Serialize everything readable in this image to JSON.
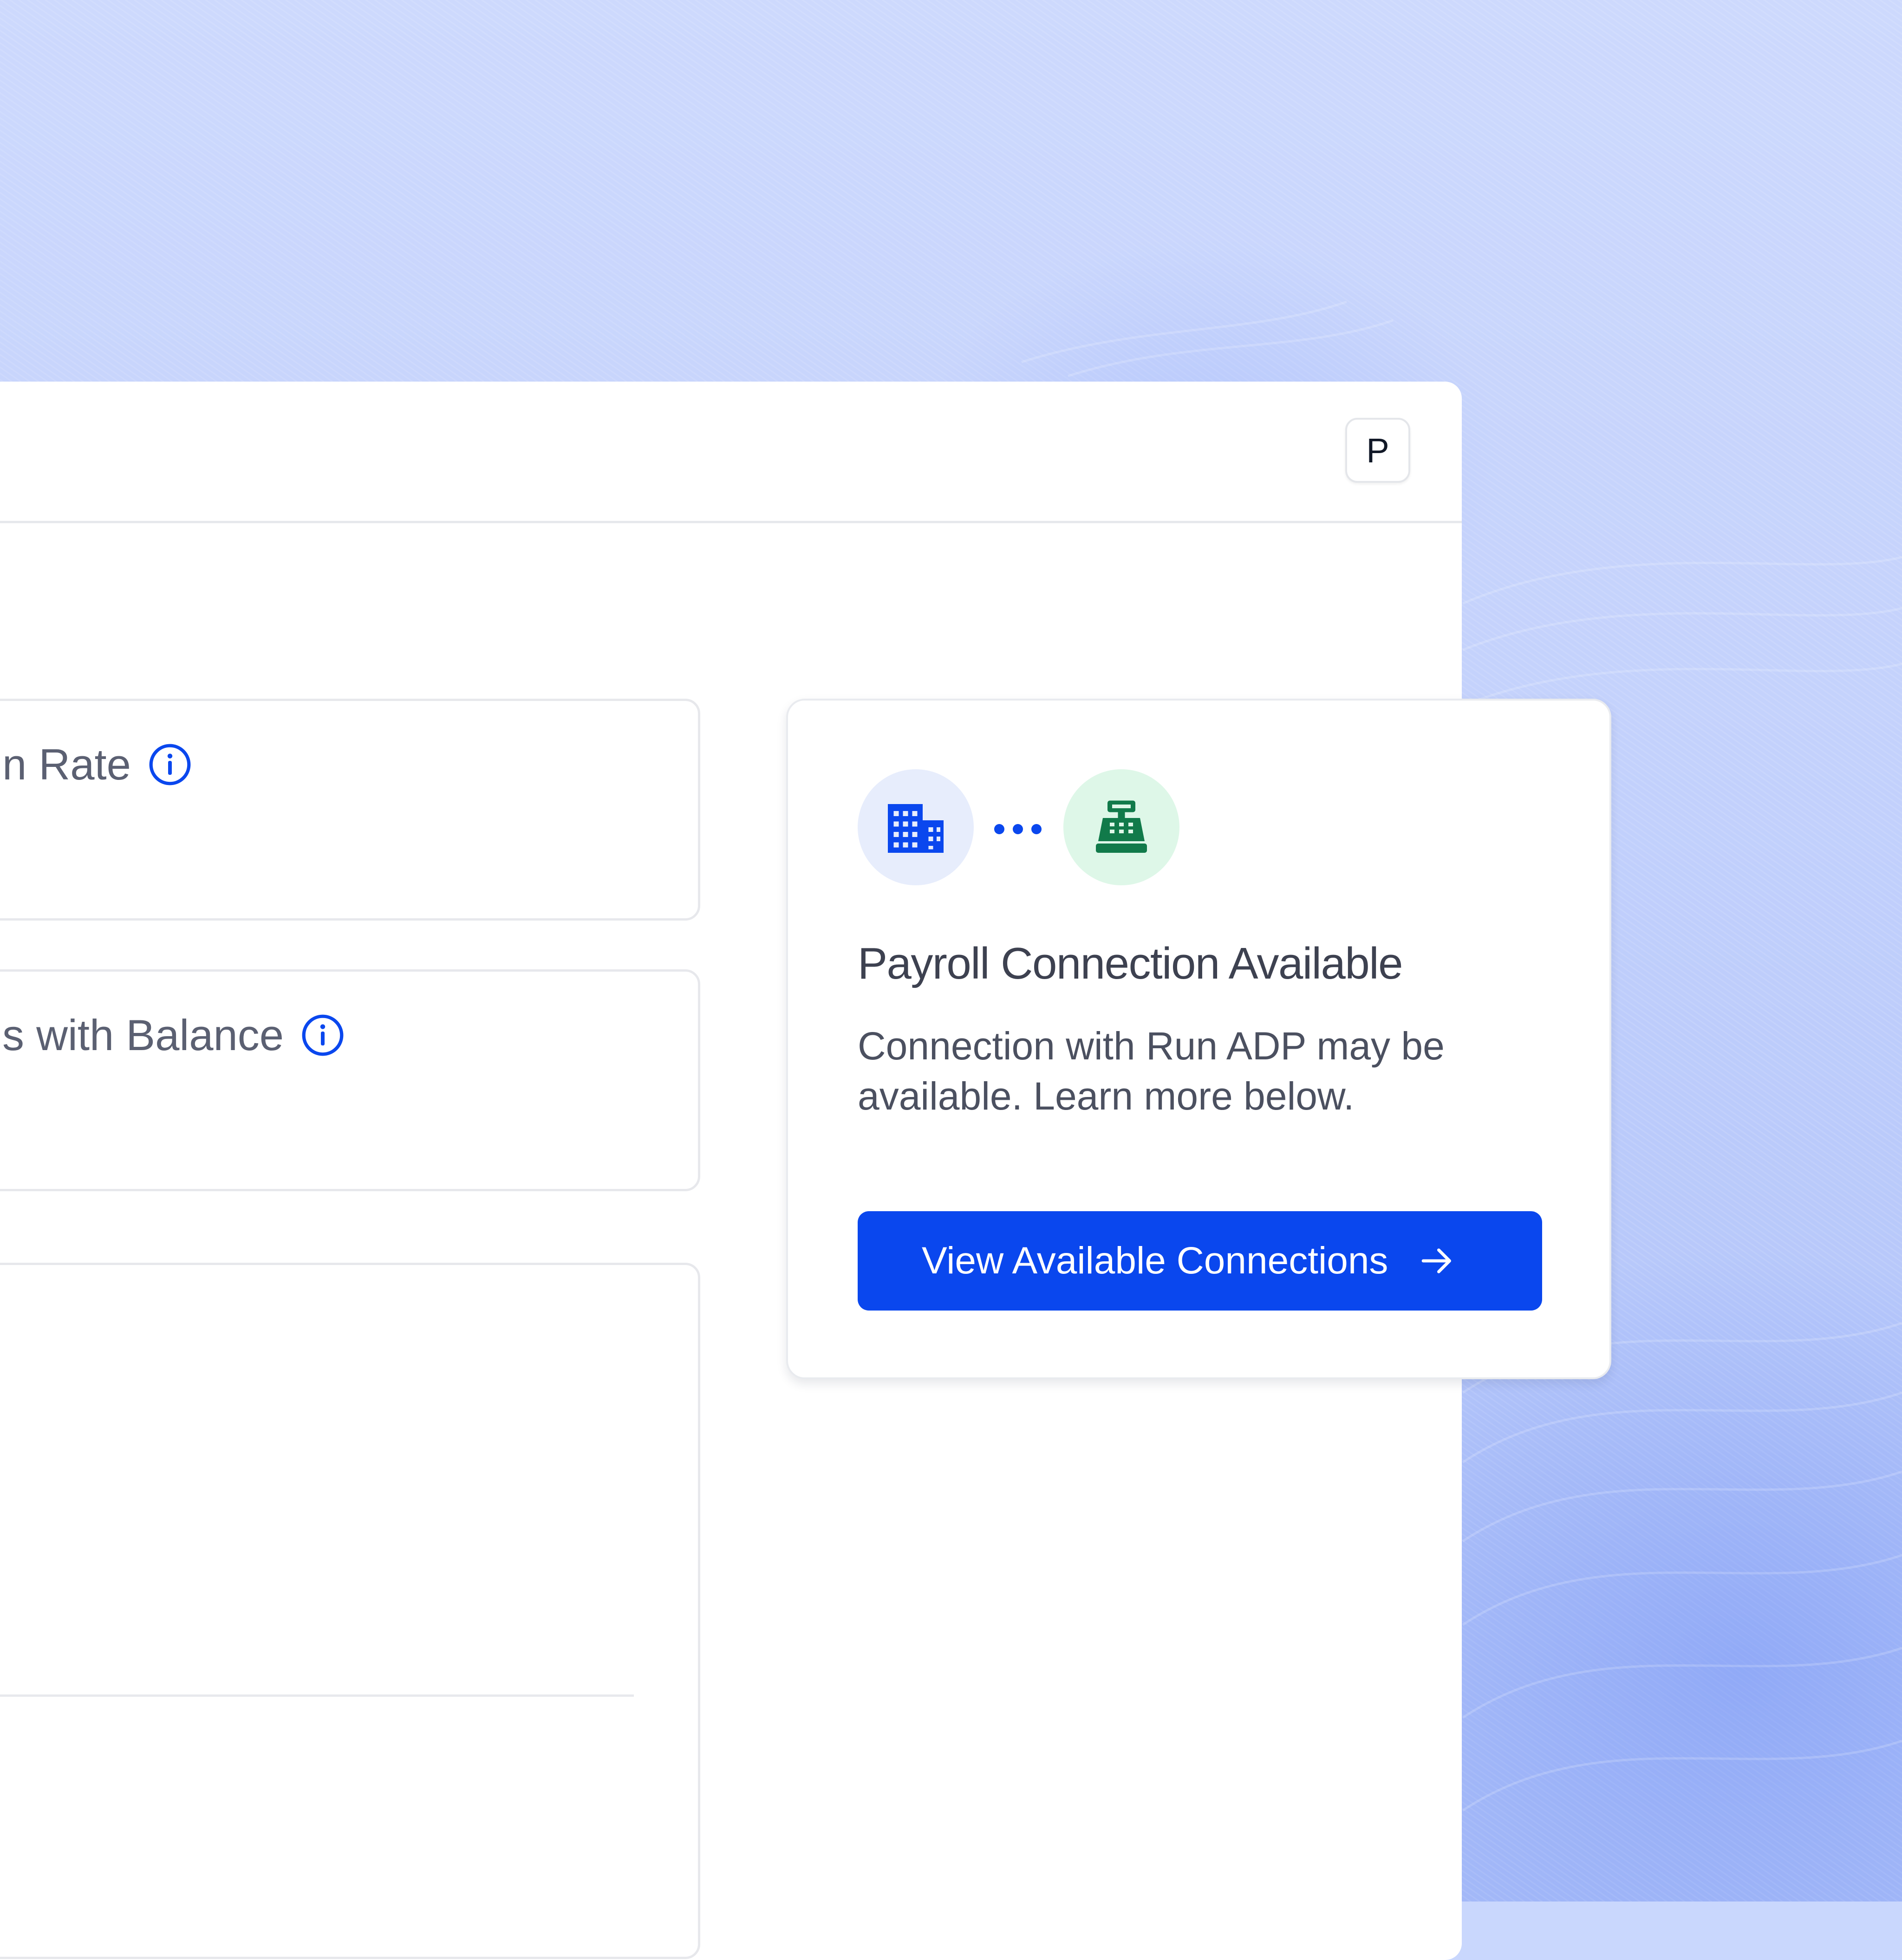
{
  "header": {
    "avatar_initial": "P"
  },
  "metrics": [
    {
      "title": "n Rate",
      "info_icon": "info-icon"
    },
    {
      "title": "s with Balance",
      "info_icon": "info-icon"
    }
  ],
  "payroll_card": {
    "left_icon": "building-icon",
    "connector_icon": "dots-icon",
    "right_icon": "cash-register-icon",
    "title": "Payroll Connection Available",
    "description": "Connection with Run ADP may be available. Learn more below.",
    "button_label": "View Available Connections",
    "button_icon": "arrow-right-icon"
  },
  "colors": {
    "accent": "#0a47ee",
    "background": "#c9d7fd",
    "building_circle": "#e7edfc",
    "register_circle": "#def7e8",
    "register_icon": "#117a4a"
  }
}
